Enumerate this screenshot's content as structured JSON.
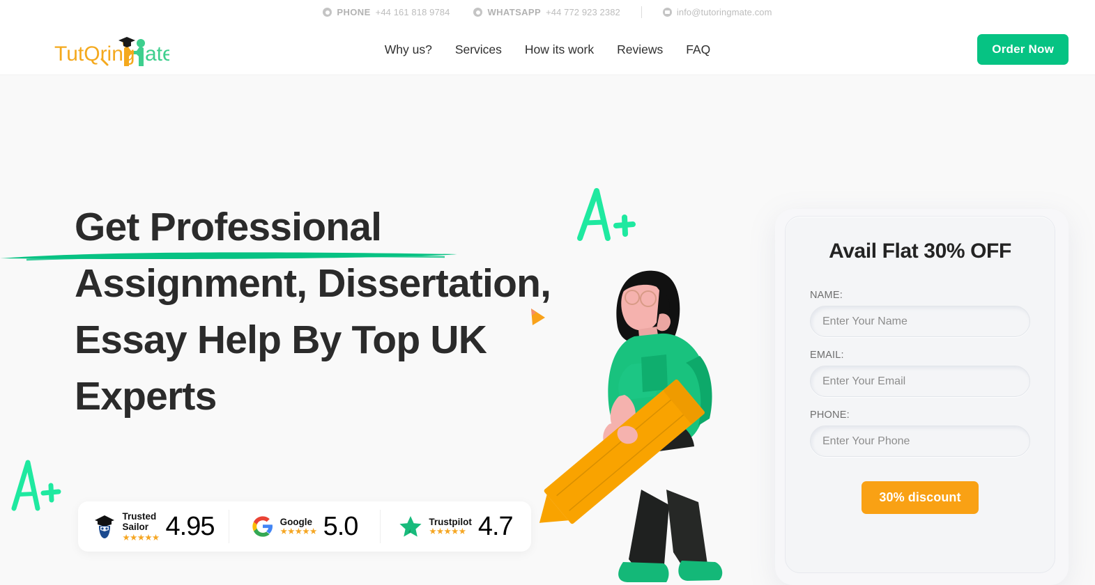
{
  "topbar": {
    "phone": {
      "icon": "phone-icon",
      "label": "PHONE",
      "value": "+44 161 818 9784"
    },
    "whatsapp": {
      "icon": "whatsapp-icon",
      "label": "WHATSAPP",
      "value": "+44 772 923 2382"
    },
    "email": {
      "icon": "mail-icon",
      "value": "info@tutoringmate.com"
    }
  },
  "header": {
    "logo": {
      "part1": "TutQring",
      "part2": "ate",
      "alt": "TutoringMate"
    },
    "nav": [
      {
        "label": "Why us?"
      },
      {
        "label": "Services"
      },
      {
        "label": "How its work"
      },
      {
        "label": "Reviews"
      },
      {
        "label": "FAQ"
      }
    ],
    "cta": {
      "label": "Order Now",
      "color": "#06c383"
    }
  },
  "hero": {
    "headline_line1": "Get Professional",
    "headline_rest": "Assignment, Dissertation, Essay Help By Top UK Experts",
    "underline_color": "#07c283",
    "doodle_text": "A+",
    "doodle_color": "#1fe9a0",
    "marker_color": "#f9a21a",
    "illustration": "student-holding-pencil-illustration"
  },
  "ratings": [
    {
      "icon": "trusted-sailor-icon",
      "name": "Trusted\nSailor",
      "stars": "★★★★★",
      "score": "4.95"
    },
    {
      "icon": "google-icon",
      "name": "Google",
      "stars": "★★★★★",
      "score": "5.0"
    },
    {
      "icon": "trustpilot-icon",
      "name": "Trustpilot",
      "stars": "★★★★★",
      "score": "4.7"
    }
  ],
  "form": {
    "title": "Avail Flat 30% OFF",
    "fields": [
      {
        "label": "NAME:",
        "placeholder": "Enter Your Name",
        "value": ""
      },
      {
        "label": "EMAIL:",
        "placeholder": "Enter Your Email",
        "value": ""
      },
      {
        "label": "PHONE:",
        "placeholder": "Enter Your Phone",
        "value": ""
      }
    ],
    "submit": {
      "label": "30% discount",
      "color": "#f9a114"
    }
  }
}
